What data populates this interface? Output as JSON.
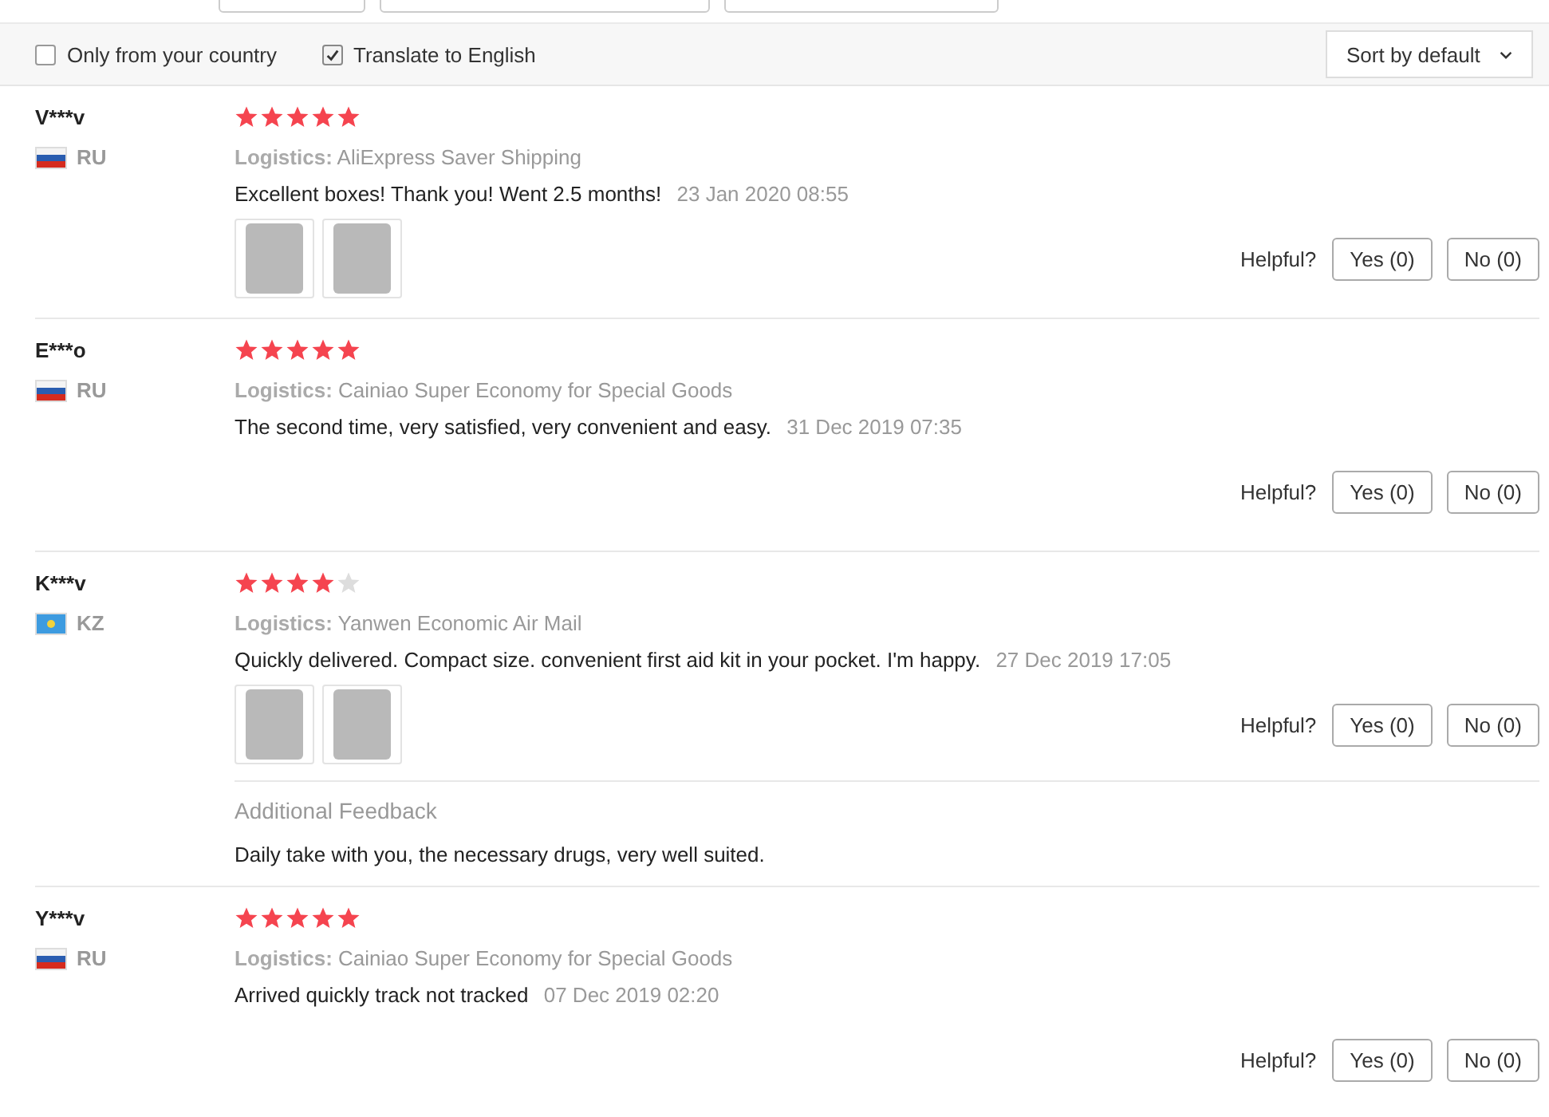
{
  "filters": {
    "options": [
      {
        "label": "Only from your country",
        "checked": false
      },
      {
        "label": "Translate to English",
        "checked": true
      }
    ],
    "sort": {
      "value": "Sort by default"
    }
  },
  "reviews": [
    {
      "name": "V***v",
      "country": "RU",
      "flag": {
        "kind": "tricolor"
      },
      "stars": 5,
      "logistics_label": "Logistics:",
      "logistics": "AliExpress Saver Shipping",
      "text": "Excellent boxes! Thank you! Went 2.5 months!",
      "date": "23 Jan 2020 08:55",
      "photos": [
        {
          "kind": "photo"
        },
        {
          "kind": "photo"
        }
      ],
      "helpful": "Helpful?",
      "yes": "Yes (0)",
      "no": "No (0)"
    },
    {
      "name": "E***o",
      "country": "RU",
      "flag": {
        "kind": "tricolor"
      },
      "stars": 5,
      "logistics_label": "Logistics:",
      "logistics": "Cainiao Super Economy for Special Goods",
      "text": "The second time, very satisfied, very convenient and easy.",
      "date": "31 Dec 2019 07:35",
      "helpful": "Helpful?",
      "yes": "Yes (0)",
      "no": "No (0)"
    },
    {
      "name": "K***v",
      "country": "KZ",
      "flag": {
        "kind": "emblem"
      },
      "stars": 4,
      "logistics_label": "Logistics:",
      "logistics": "Yanwen Economic Air Mail",
      "text": "Quickly delivered. Compact size. convenient first aid kit in your pocket. I'm happy.",
      "date": "27 Dec 2019 17:05",
      "photos": [
        {
          "kind": "photo"
        },
        {
          "kind": "photo"
        }
      ],
      "helpful": "Helpful?",
      "yes": "Yes (0)",
      "no": "No (0)",
      "additional": {
        "title": "Additional Feedback",
        "text": "Daily take with you, the necessary drugs, very well suited."
      }
    },
    {
      "name": "Y***v",
      "country": "RU",
      "flag": {
        "kind": "tricolor"
      },
      "stars": 5,
      "logistics_label": "Logistics:",
      "logistics": "Cainiao Super Economy for Special Goods",
      "text": "Arrived quickly track not tracked",
      "date": "07 Dec 2019 02:20",
      "helpful": "Helpful?",
      "yes": "Yes (0)",
      "no": "No (0)"
    }
  ]
}
